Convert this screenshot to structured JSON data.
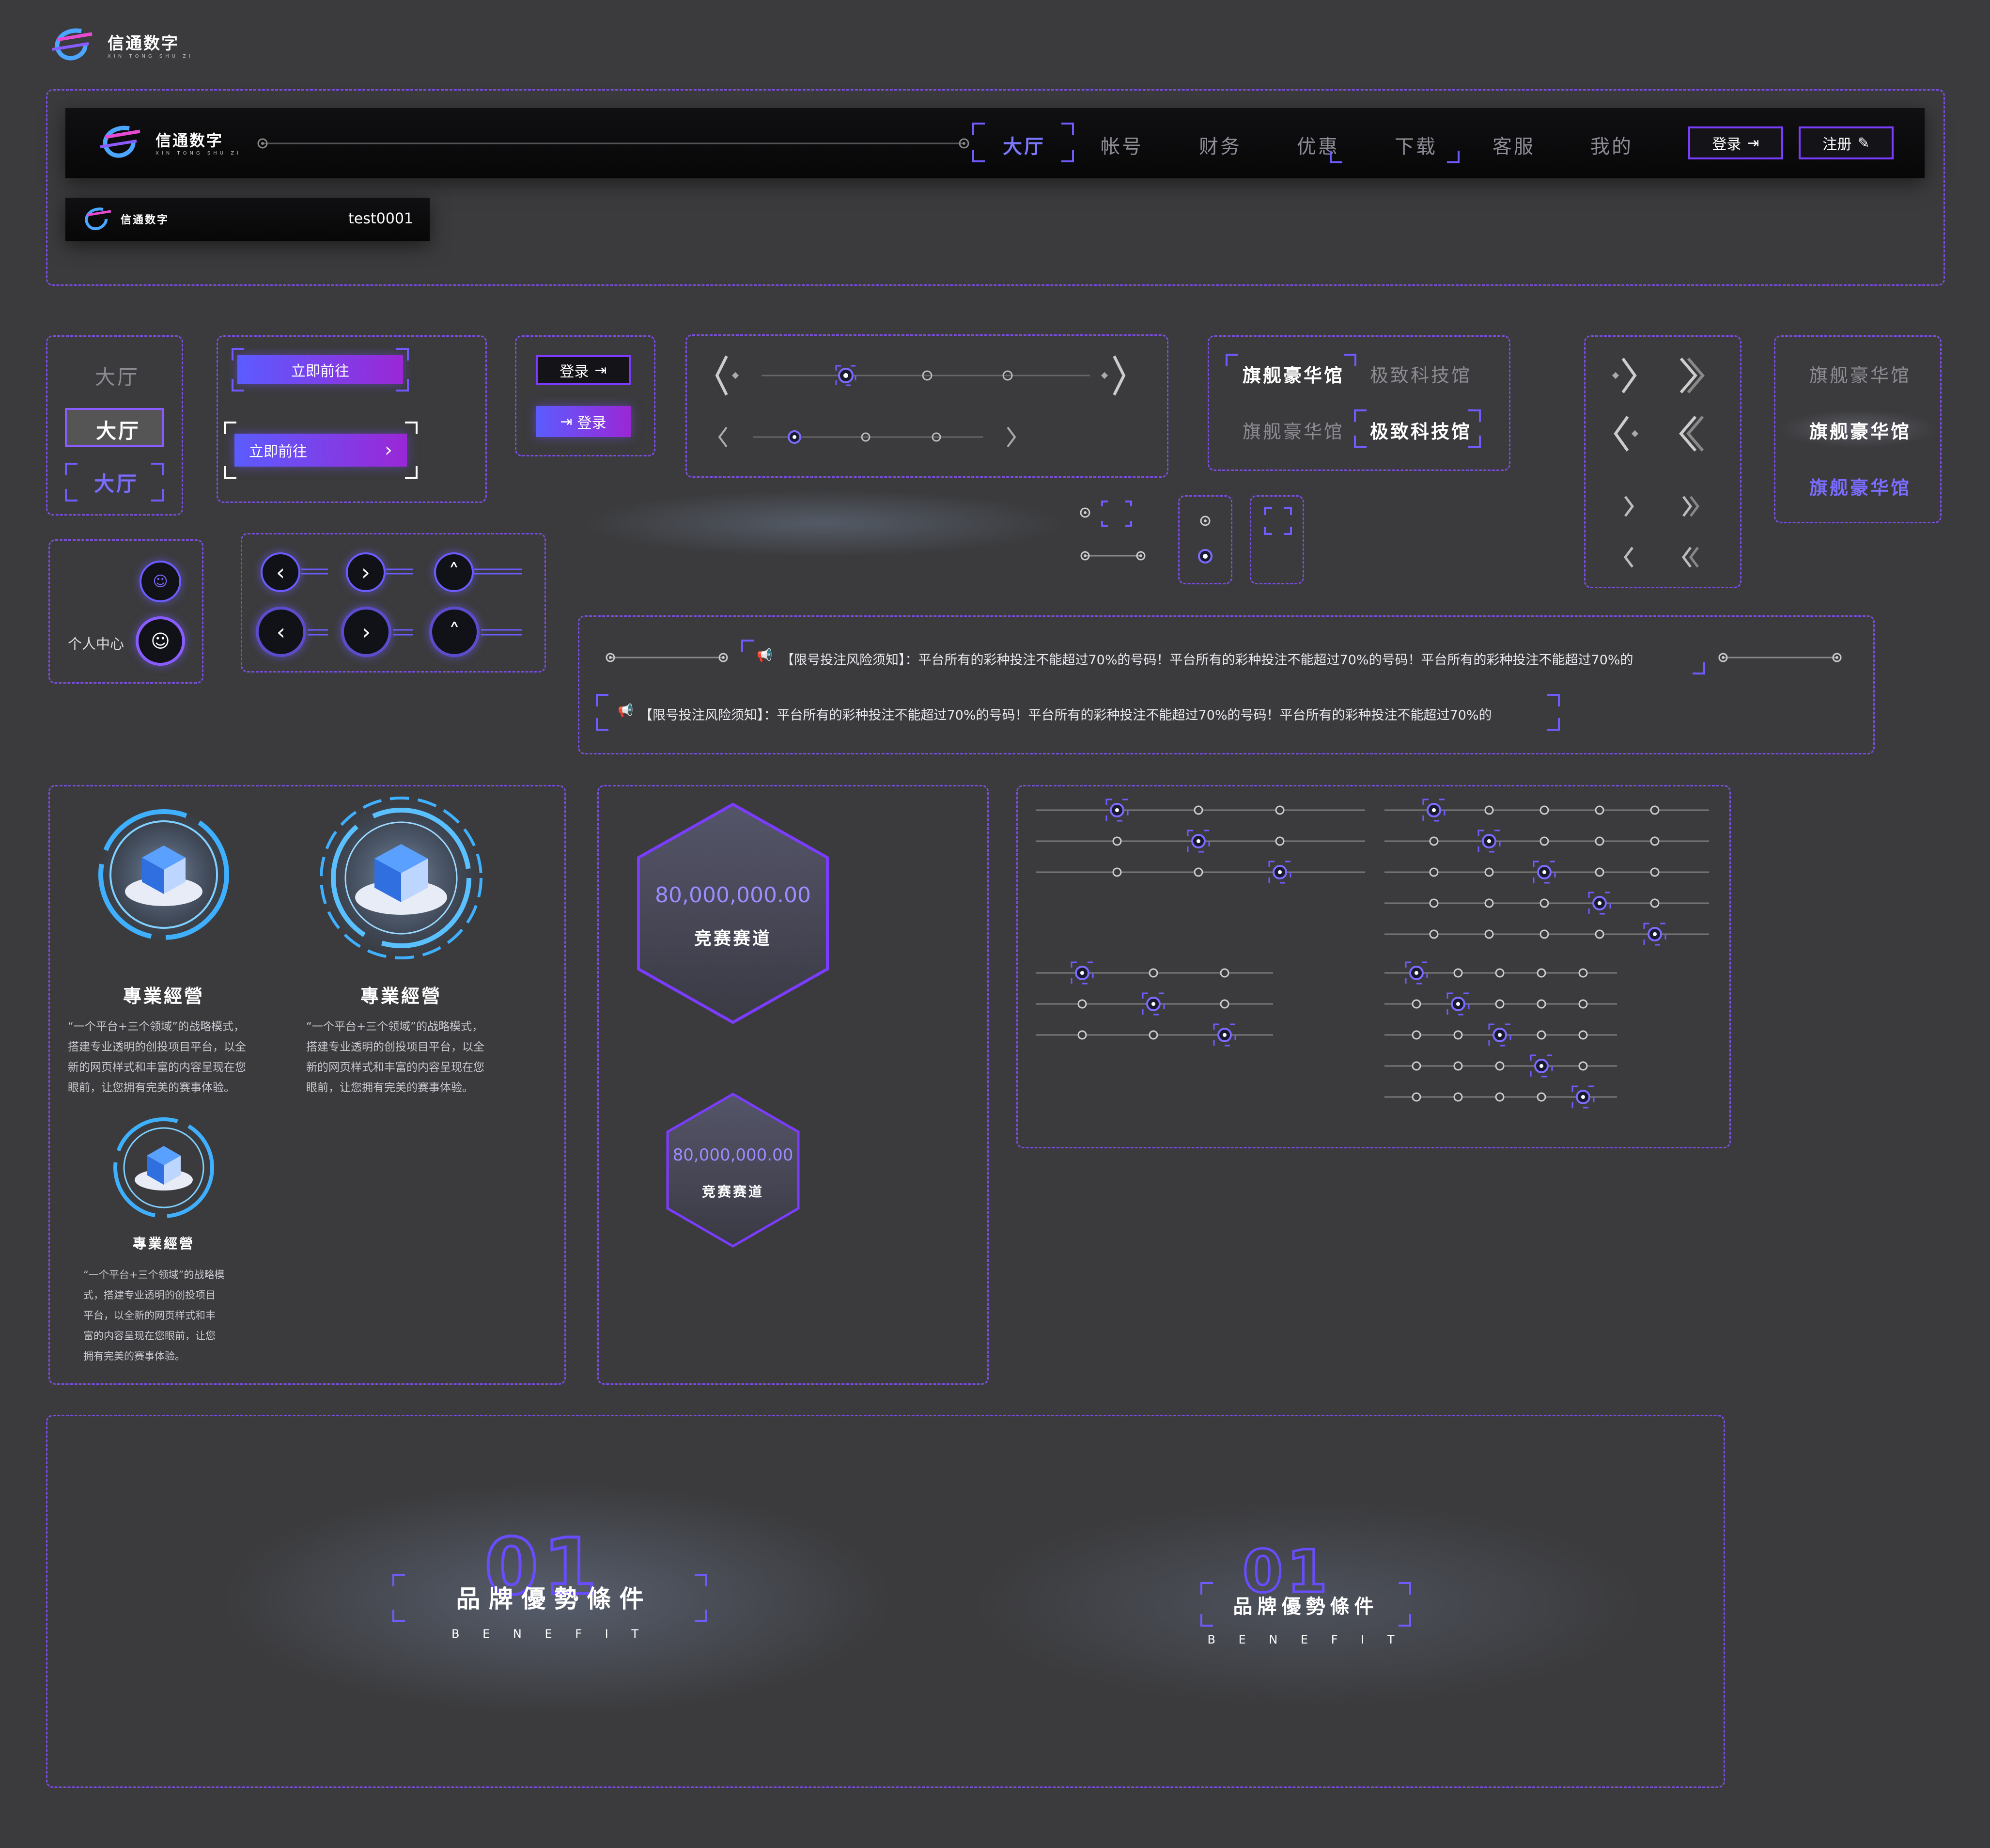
{
  "brand": {
    "name": "信通数字",
    "sub": "XIN TONG SHU ZI"
  },
  "nav": {
    "items": [
      "大厅",
      "帐号",
      "财务",
      "优惠",
      "下载",
      "客服",
      "我的"
    ],
    "active": "大厅",
    "login": "登录",
    "register": "注册"
  },
  "mini_bar": {
    "user": "test0001"
  },
  "tabs_vertical": [
    "大厅",
    "大厅",
    "大厅"
  ],
  "go_buttons": [
    "立即前往",
    "立即前往"
  ],
  "login_buttons": [
    "登录",
    "登录"
  ],
  "venue_tabs": [
    "旗舰豪华馆",
    "极致科技馆",
    "旗舰豪华馆",
    "极致科技馆"
  ],
  "venue_tabs_right": [
    "旗舰豪华馆",
    "旗舰豪华馆",
    "旗舰豪华馆"
  ],
  "personal_center": "个人中心",
  "notices": [
    "【限号投注风险须知】：平台所有的彩种投注不能超过70%的号码！平台所有的彩种投注不能超过70%的号码！平台所有的彩种投注不能超过70%的",
    "【限号投注风险须知】：平台所有的彩种投注不能超过70%的号码！平台所有的彩种投注不能超过70%的号码！平台所有的彩种投注不能超过70%的"
  ],
  "features": [
    {
      "title": "專業經營",
      "lines": [
        "“一个平台+三个领域”的战略模式，",
        "搭建专业透明的创投项目平台，以全",
        "新的网页样式和丰富的内容呈现在您",
        "眼前，让您拥有完美的赛事体验。"
      ]
    },
    {
      "title": "專業經營",
      "lines": [
        "“一个平台+三个领域”的战略模式，",
        "搭建专业透明的创投项目平台，以全",
        "新的网页样式和丰富的内容呈现在您",
        "眼前，让您拥有完美的赛事体验。"
      ]
    },
    {
      "title": "專業經營",
      "lines": [
        "“一个平台+三个领域”的战略模",
        "式，搭建专业透明的创投项目",
        "平台，以全新的网页样式和丰",
        "富的内容呈现在您眼前，让您",
        "拥有完美的赛事体验。"
      ]
    }
  ],
  "hexagons": [
    {
      "value": "80,000,000.00",
      "label": "竞赛赛道"
    },
    {
      "value": "80,000,000.00",
      "label": "竞赛赛道"
    }
  ],
  "benefit": [
    {
      "num": "01",
      "title": "品 牌 優 勢 條 件",
      "sub": "B E N E F I T"
    },
    {
      "num": "01",
      "title": "品牌優勢條件",
      "sub": "B E N E F I T"
    }
  ],
  "colors": {
    "accent": "#6f5cff",
    "purple": "#9a27d6",
    "bg": "#3b3b3d",
    "border": "#7b4ce0"
  }
}
